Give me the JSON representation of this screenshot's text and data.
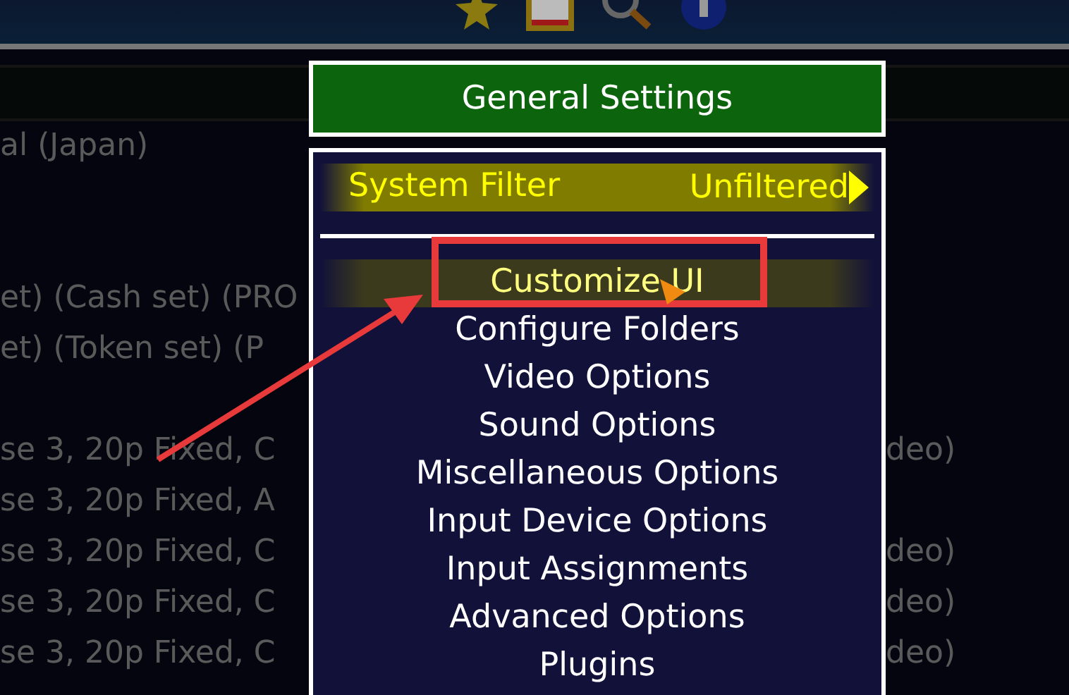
{
  "game_list": {
    "rows": [
      {
        "left": "al (Japan)"
      },
      {},
      {},
      {
        "left": "et) (Cash set) (PRO"
      },
      {
        "left": "et) (Token set) (P"
      },
      {},
      {
        "left": "se 3, 20p Fixed, C",
        "right": "deo)"
      },
      {
        "left": "se 3, 20p Fixed, A"
      },
      {
        "left": "se 3, 20p Fixed, C",
        "right": "deo)"
      },
      {
        "left": "se 3, 20p Fixed, C",
        "right": "deo)"
      },
      {
        "left": "se 3, 20p Fixed, C",
        "right": "deo)"
      }
    ]
  },
  "menu": {
    "title": "General Settings",
    "items": [
      {
        "kind": "option",
        "label": "System Filter",
        "value": "Unfiltered",
        "selected": true,
        "hovered": false
      },
      {
        "kind": "separator"
      },
      {
        "kind": "entry",
        "label": "Customize UI",
        "selected": false,
        "hovered": true
      },
      {
        "kind": "entry",
        "label": "Configure Folders",
        "selected": false,
        "hovered": false
      },
      {
        "kind": "entry",
        "label": "Video Options",
        "selected": false,
        "hovered": false
      },
      {
        "kind": "entry",
        "label": "Sound Options",
        "selected": false,
        "hovered": false
      },
      {
        "kind": "entry",
        "label": "Miscellaneous Options",
        "selected": false,
        "hovered": false
      },
      {
        "kind": "entry",
        "label": "Input Device Options",
        "selected": false,
        "hovered": false
      },
      {
        "kind": "entry",
        "label": "Input Assignments",
        "selected": false,
        "hovered": false
      },
      {
        "kind": "entry",
        "label": "Advanced Options",
        "selected": false,
        "hovered": false
      },
      {
        "kind": "entry",
        "label": "Plugins",
        "selected": false,
        "hovered": false
      }
    ]
  }
}
